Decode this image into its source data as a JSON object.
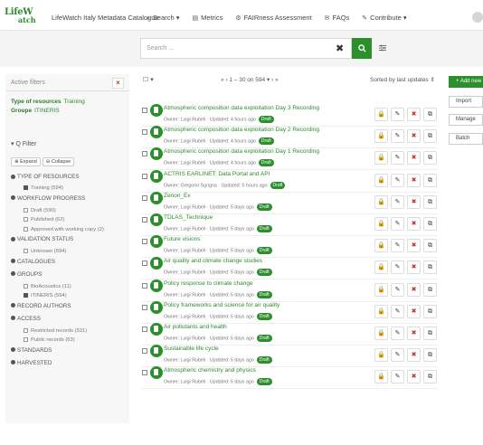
{
  "nav": {
    "logo_line1": "LifeW",
    "logo_line2": "atch",
    "title": "LifeWatch Italy Metadata Catalogue",
    "links": [
      {
        "icon": "search-icon",
        "label": "Search ▾"
      },
      {
        "icon": "chart-icon",
        "label": "Metrics"
      },
      {
        "icon": "gear-icon",
        "label": "FAIRness Assessment"
      },
      {
        "icon": "chat-icon",
        "label": "FAQs"
      },
      {
        "icon": "pencil-icon",
        "label": "Contribute ▾"
      }
    ]
  },
  "search": {
    "placeholder": "Search ...",
    "clear_icon": "✖",
    "button_icon": "search-icon",
    "options_icon": "sliders-icon"
  },
  "active_filters": {
    "title": "Active filters",
    "rows": [
      {
        "key": "Type of resources",
        "value": "Training"
      },
      {
        "key": "Groupe",
        "value": "ITINERIS"
      }
    ]
  },
  "filter": {
    "title": "▾ Q Filter",
    "expand_label": "Expand",
    "collapse_label": "Collapse",
    "items": [
      {
        "kind": "cat",
        "label": "TYPE OF RESOURCES"
      },
      {
        "kind": "sub",
        "checked": true,
        "label": "Training (594)"
      },
      {
        "kind": "cat",
        "label": "WORKFLOW PROGRESS"
      },
      {
        "kind": "sub",
        "checked": false,
        "label": "Draft (590)"
      },
      {
        "kind": "sub",
        "checked": false,
        "label": "Published (62)"
      },
      {
        "kind": "sub",
        "checked": false,
        "label": "Approved with working copy (2)"
      },
      {
        "kind": "cat",
        "label": "VALIDATION STATUS"
      },
      {
        "kind": "sub",
        "checked": false,
        "label": "Unknown (594)"
      },
      {
        "kind": "cat",
        "label": "CATALOGUES"
      },
      {
        "kind": "cat",
        "label": "GROUPS"
      },
      {
        "kind": "sub",
        "checked": false,
        "label": "BioAcoustics (11)"
      },
      {
        "kind": "sub",
        "checked": true,
        "label": "ITINERIS (594)"
      },
      {
        "kind": "cat",
        "label": "RECORD AUTHORS"
      },
      {
        "kind": "cat",
        "label": "ACCESS"
      },
      {
        "kind": "sub",
        "checked": false,
        "label": "Restricted records (531)"
      },
      {
        "kind": "sub",
        "checked": false,
        "label": "Public records (63)"
      },
      {
        "kind": "cat",
        "label": "STANDARDS"
      },
      {
        "kind": "cat",
        "label": "HARVESTED"
      }
    ]
  },
  "list": {
    "select_label": "☐ ▾",
    "pager": "«  ‹   1 – 30 on 594 ▾  ›  »",
    "sort": "Sorted by last updates ⇕",
    "draft_badge": "Draft",
    "records": [
      {
        "title": "Atmospheric composition data exploitation Day 3 Recording",
        "meta": "Owner: Luigi Rubeli · Updated: 4 hours ago"
      },
      {
        "title": "Atmospheric composition data exploitation Day 2 Recording",
        "meta": "Owner: Luigi Rubeli · Updated: 4 hours ago"
      },
      {
        "title": "Atmospheric composition data exploitation Day 1 Recording",
        "meta": "Owner: Luigi Rubeli · Updated: 4 hours ago"
      },
      {
        "title": "ACTRIS EARLINET: Data Portal and API",
        "meta": "Owner: Gregorio Sgrigna · Updated: 5 hours ago"
      },
      {
        "title": "Zenon_Ex",
        "meta": "Owner: Luigi Rubeli · Updated: 5 days ago"
      },
      {
        "title": "TDLAS_Technique",
        "meta": "Owner: Luigi Rubeli · Updated: 5 days ago"
      },
      {
        "title": "Future visions",
        "meta": "Owner: Luigi Rubeli · Updated: 5 days ago"
      },
      {
        "title": "Air quality and climate change studies",
        "meta": "Owner: Luigi Rubeli · Updated: 5 days ago"
      },
      {
        "title": "Policy response to climate change",
        "meta": "Owner: Luigi Rubeli · Updated: 5 days ago"
      },
      {
        "title": "Policy frameworks and science for air quality",
        "meta": "Owner: Luigi Rubeli · Updated: 5 days ago"
      },
      {
        "title": "Air pollutants and health",
        "meta": "Owner: Luigi Rubeli · Updated: 5 days ago"
      },
      {
        "title": "Sustainable life cycle",
        "meta": "Owner: Luigi Rubeli · Updated: 5 days ago"
      },
      {
        "title": "Atmospheric chemistry and physics",
        "meta": "Owner: Luigi Rubeli · Updated: 5 days ago"
      }
    ],
    "actions": [
      {
        "name": "lock-icon",
        "glyph": "🔒"
      },
      {
        "name": "pencil-icon",
        "glyph": "✎"
      },
      {
        "name": "delete-icon",
        "glyph": "✖"
      },
      {
        "name": "copy-icon",
        "glyph": "⧉"
      }
    ]
  },
  "right": {
    "buttons": [
      {
        "label": "+ Add new",
        "primary": true
      },
      {
        "label": "Import",
        "primary": false
      },
      {
        "label": "Manage",
        "primary": false
      },
      {
        "label": "Batch",
        "primary": false
      }
    ]
  },
  "colors": {
    "accent": "#2b8f2b",
    "danger": "#c0392b"
  }
}
